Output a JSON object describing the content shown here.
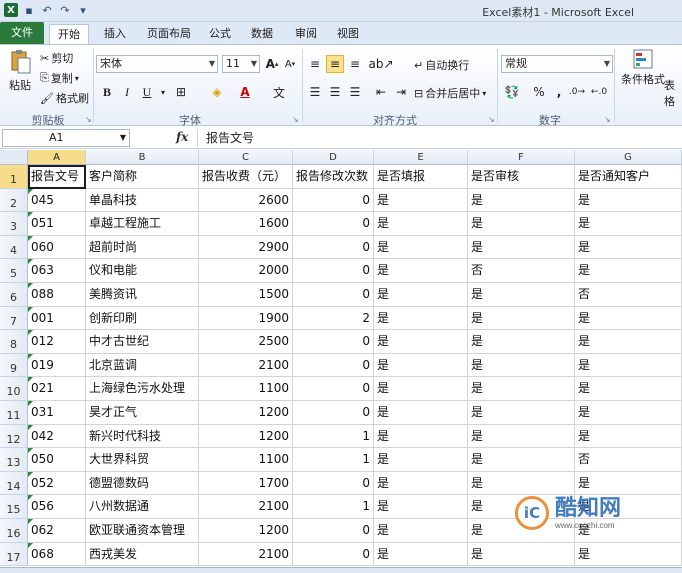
{
  "window": {
    "title": "Excel素材1 - Microsoft Excel"
  },
  "ribbon": {
    "tabs": [
      "文件",
      "开始",
      "插入",
      "页面布局",
      "公式",
      "数据",
      "审阅",
      "视图"
    ],
    "clipboard": {
      "paste": "粘贴",
      "cut": "剪切",
      "copy": "复制",
      "format_painter": "格式刷",
      "label": "剪贴板"
    },
    "font": {
      "name": "宋体",
      "size": "11",
      "grow": "A",
      "shrink": "A",
      "bold": "B",
      "italic": "I",
      "underline": "U",
      "label": "字体"
    },
    "alignment": {
      "wrap": "自动换行",
      "merge": "合并后居中",
      "label": "对齐方式"
    },
    "number": {
      "format": "常规",
      "percent": "%",
      "comma": ",",
      "label": "数字"
    },
    "styles": {
      "conditional": "条件格式",
      "table_format": "表格"
    }
  },
  "formula_bar": {
    "name_box": "A1",
    "fx": "fx",
    "content": "报告文号"
  },
  "grid": {
    "columns": [
      "A",
      "B",
      "C",
      "D",
      "E",
      "F",
      "G"
    ],
    "rows": [
      [
        "报告文号",
        "客户简称",
        "报告收费（元）",
        "报告修改次数",
        "是否填报",
        "是否审核",
        "是否通知客户"
      ],
      [
        "045",
        "单晶科技",
        "2600",
        "0",
        "是",
        "是",
        "是"
      ],
      [
        "051",
        "卓越工程施工",
        "1600",
        "0",
        "是",
        "是",
        "是"
      ],
      [
        "060",
        "超前时尚",
        "2900",
        "0",
        "是",
        "是",
        "是"
      ],
      [
        "063",
        "仪和电能",
        "2000",
        "0",
        "是",
        "否",
        "是"
      ],
      [
        "088",
        "美腾资讯",
        "1500",
        "0",
        "是",
        "是",
        "否"
      ],
      [
        "001",
        "创新印刷",
        "1900",
        "2",
        "是",
        "是",
        "是"
      ],
      [
        "012",
        "中才古世纪",
        "2500",
        "0",
        "是",
        "是",
        "是"
      ],
      [
        "019",
        "北京蓝调",
        "2100",
        "0",
        "是",
        "是",
        "是"
      ],
      [
        "021",
        "上海绿色污水处理",
        "1100",
        "0",
        "是",
        "是",
        "是"
      ],
      [
        "031",
        "昊才正气",
        "1200",
        "0",
        "是",
        "是",
        "是"
      ],
      [
        "042",
        "新兴时代科技",
        "1200",
        "1",
        "是",
        "是",
        "是"
      ],
      [
        "050",
        "大世界科贸",
        "1100",
        "1",
        "是",
        "是",
        "否"
      ],
      [
        "052",
        "德盟德数码",
        "1700",
        "0",
        "是",
        "是",
        "是"
      ],
      [
        "056",
        "八州数据通",
        "2100",
        "1",
        "是",
        "是",
        "是"
      ],
      [
        "062",
        "欧亚联通资本管理",
        "1200",
        "0",
        "是",
        "是",
        "是"
      ],
      [
        "068",
        "西戎美发",
        "2100",
        "0",
        "是",
        "是",
        "是"
      ]
    ]
  },
  "watermark": {
    "name": "酷知网",
    "url": "www.coozhi.com"
  }
}
